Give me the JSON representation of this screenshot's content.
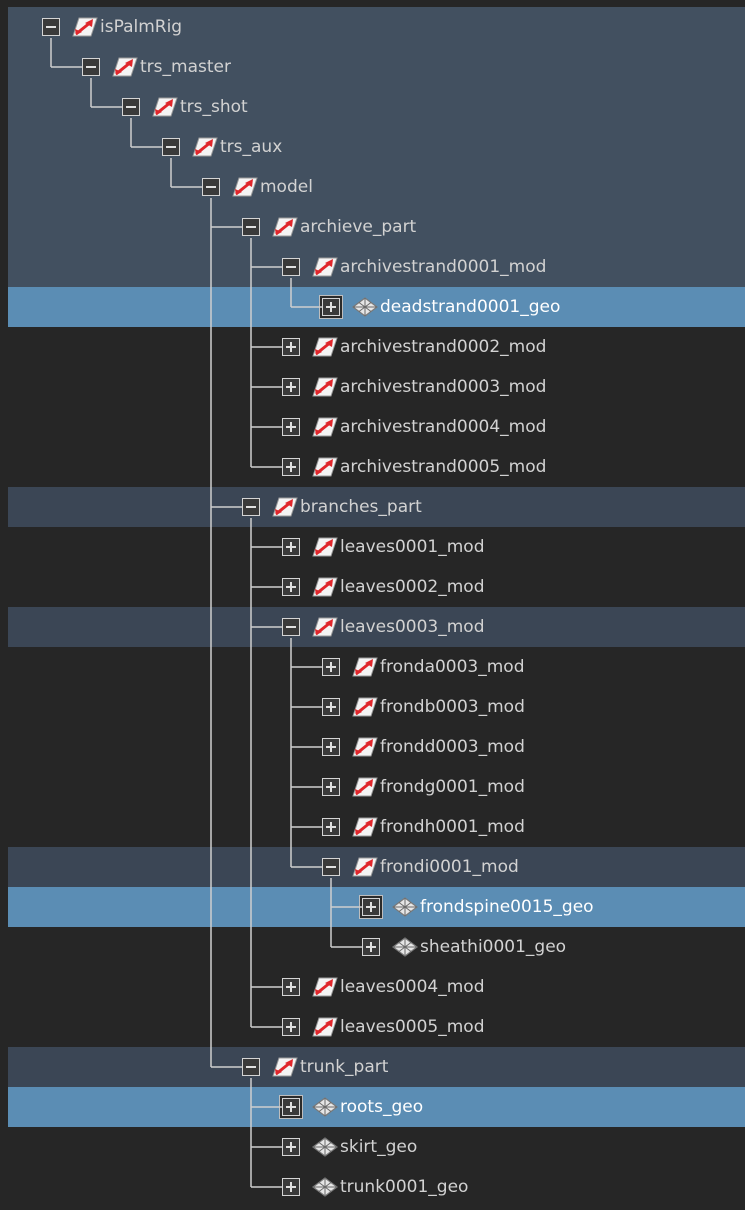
{
  "outliner": {
    "nodes": [
      {
        "label": "isPalmRig",
        "kind": "transform",
        "depth": 0,
        "state": "expanded",
        "bg": "blue"
      },
      {
        "label": "trs_master",
        "kind": "transform",
        "depth": 1,
        "state": "expanded",
        "bg": "blue"
      },
      {
        "label": "trs_shot",
        "kind": "transform",
        "depth": 2,
        "state": "expanded",
        "bg": "blue"
      },
      {
        "label": "trs_aux",
        "kind": "transform",
        "depth": 3,
        "state": "expanded",
        "bg": "blue"
      },
      {
        "label": "model",
        "kind": "transform",
        "depth": 4,
        "state": "expanded",
        "bg": "blue"
      },
      {
        "label": "archieve_part",
        "kind": "transform",
        "depth": 5,
        "state": "expanded",
        "bg": "blue"
      },
      {
        "label": "archivestrand0001_mod",
        "kind": "transform",
        "depth": 6,
        "state": "expanded",
        "bg": "blue"
      },
      {
        "label": "deadstrand0001_geo",
        "kind": "mesh",
        "depth": 7,
        "state": "collapsed",
        "bg": "selected"
      },
      {
        "label": "archivestrand0002_mod",
        "kind": "transform",
        "depth": 6,
        "state": "collapsed",
        "bg": "dark"
      },
      {
        "label": "archivestrand0003_mod",
        "kind": "transform",
        "depth": 6,
        "state": "collapsed",
        "bg": "dark"
      },
      {
        "label": "archivestrand0004_mod",
        "kind": "transform",
        "depth": 6,
        "state": "collapsed",
        "bg": "dark"
      },
      {
        "label": "archivestrand0005_mod",
        "kind": "transform",
        "depth": 6,
        "state": "collapsed",
        "bg": "dark"
      },
      {
        "label": "branches_part",
        "kind": "transform",
        "depth": 5,
        "state": "expanded",
        "bg": "grey"
      },
      {
        "label": "leaves0001_mod",
        "kind": "transform",
        "depth": 6,
        "state": "collapsed",
        "bg": "dark"
      },
      {
        "label": "leaves0002_mod",
        "kind": "transform",
        "depth": 6,
        "state": "collapsed",
        "bg": "dark"
      },
      {
        "label": "leaves0003_mod",
        "kind": "transform",
        "depth": 6,
        "state": "expanded",
        "bg": "grey"
      },
      {
        "label": "fronda0003_mod",
        "kind": "transform",
        "depth": 7,
        "state": "collapsed",
        "bg": "dark"
      },
      {
        "label": "frondb0003_mod",
        "kind": "transform",
        "depth": 7,
        "state": "collapsed",
        "bg": "dark"
      },
      {
        "label": "frondd0003_mod",
        "kind": "transform",
        "depth": 7,
        "state": "collapsed",
        "bg": "dark"
      },
      {
        "label": "frondg0001_mod",
        "kind": "transform",
        "depth": 7,
        "state": "collapsed",
        "bg": "dark"
      },
      {
        "label": "frondh0001_mod",
        "kind": "transform",
        "depth": 7,
        "state": "collapsed",
        "bg": "dark"
      },
      {
        "label": "frondi0001_mod",
        "kind": "transform",
        "depth": 7,
        "state": "expanded",
        "bg": "grey"
      },
      {
        "label": "frondspine0015_geo",
        "kind": "mesh",
        "depth": 8,
        "state": "collapsed",
        "bg": "selected"
      },
      {
        "label": "sheathi0001_geo",
        "kind": "mesh",
        "depth": 8,
        "state": "collapsed",
        "bg": "dark"
      },
      {
        "label": "leaves0004_mod",
        "kind": "transform",
        "depth": 6,
        "state": "collapsed",
        "bg": "dark"
      },
      {
        "label": "leaves0005_mod",
        "kind": "transform",
        "depth": 6,
        "state": "collapsed",
        "bg": "dark"
      },
      {
        "label": "trunk_part",
        "kind": "transform",
        "depth": 5,
        "state": "expanded",
        "bg": "grey"
      },
      {
        "label": "roots_geo",
        "kind": "mesh",
        "depth": 6,
        "state": "collapsed",
        "bg": "selected"
      },
      {
        "label": "skirt_geo",
        "kind": "mesh",
        "depth": 6,
        "state": "collapsed",
        "bg": "dark"
      },
      {
        "label": "trunk0001_geo",
        "kind": "mesh",
        "depth": 6,
        "state": "collapsed",
        "bg": "dark"
      }
    ]
  },
  "colors": {
    "row_dark": "#262626",
    "row_blue": "#425060",
    "row_selected": "#5b8db4",
    "row_grey": "#3b4655",
    "tree_line": "#cfcfcf",
    "transform_icon_red": "#e0262b"
  },
  "icons": {
    "transform": "transform-icon",
    "mesh": "mesh-icon",
    "expand": "plus-icon",
    "collapse": "minus-icon"
  }
}
